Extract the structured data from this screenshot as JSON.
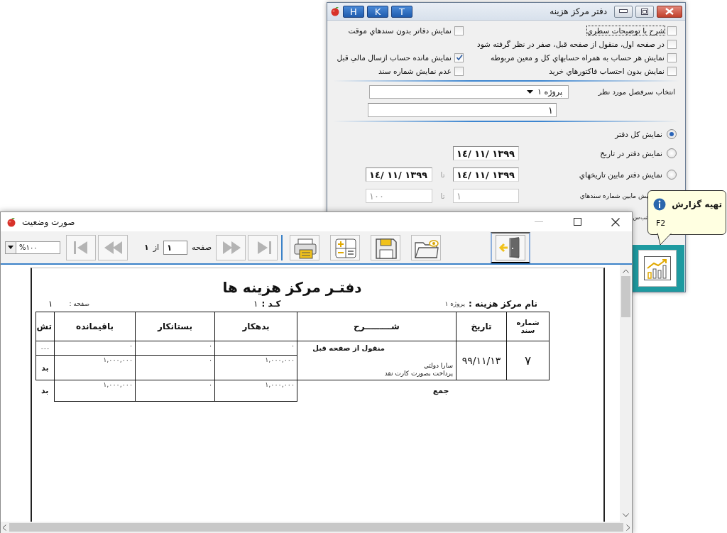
{
  "settings_dialog": {
    "title": "دفتر مركز هزينه",
    "title_buttons": [
      "T",
      "K",
      "H"
    ],
    "option_rows": [
      [
        {
          "label": "شرح با توضيحات سطري",
          "checked": false,
          "focused": true
        },
        {
          "label": "نمايش دفاتر بدون سندهاي موقت",
          "checked": false,
          "focused": false
        }
      ],
      [
        {
          "label": "در صفحه اول، منقول از صفحه قبل، صفر در نظر گرفته شود",
          "checked": false,
          "focused": false
        }
      ],
      [
        {
          "label": "نمايش هر حساب به همراه حسابهاي كل و معين مربوطه",
          "checked": false,
          "focused": false
        },
        {
          "label": "نمايش مانده حساب ازسال مالي قبل",
          "checked": true,
          "focused": false
        }
      ],
      [
        {
          "label": "نمايش بدون احتساب فاكتورهاي خريد",
          "checked": false,
          "focused": false
        },
        {
          "label": "عدم نمايش شماره سند",
          "checked": false,
          "focused": false
        }
      ]
    ],
    "cost_center": {
      "label": "انتخاب سرفصل مورد نظر",
      "value": "پروژه ١"
    },
    "account_field": {
      "value": "١"
    },
    "range_options": [
      {
        "label": "نمايش كل دفتر",
        "selected": true
      },
      {
        "label": "نمايش دفتر در تاريخ",
        "selected": false,
        "fields": [
          {
            "value": "١٣٩٩ /١١ /١٤",
            "disabled": false
          }
        ]
      },
      {
        "label": "نمايش دفتر مابين تاريخهاي",
        "selected": false,
        "separator": "تا",
        "fields": [
          {
            "value": "١٣٩٩ /١١ /١٤",
            "disabled": false
          },
          {
            "value": "١٣٩٩ /١١ /١٤",
            "disabled": false
          }
        ]
      },
      {
        "label": "يش مابين شماره سندهاي",
        "separator": "تا",
        "fields": [
          {
            "value": "١",
            "disabled": true
          },
          {
            "value": "١٠٠",
            "disabled": true
          }
        ]
      },
      {
        "label": "تب س"
      }
    ],
    "tooltip": {
      "title": "تهيه گزارش",
      "shortcut": "F2"
    }
  },
  "report_window": {
    "title": "صورت وضعيت",
    "zoom": "%١٠٠",
    "page_label": "صفحه",
    "page_value": "١",
    "of_label": "از",
    "page_count": "١",
    "nav_buttons": [
      {
        "kind": "first",
        "disabled": true
      },
      {
        "kind": "prev",
        "disabled": true
      },
      {
        "kind": "next",
        "disabled": true
      },
      {
        "kind": "last",
        "disabled": true
      }
    ],
    "tools": [
      {
        "kind": "print"
      },
      {
        "kind": "calculator"
      },
      {
        "kind": "save"
      },
      {
        "kind": "open"
      }
    ],
    "ledger": {
      "title": "دفتـر  مركز هزينه ها",
      "cost_center_label": "نام مركز هزينه :",
      "cost_center_value": "پروژه ١",
      "code_label": "كـد :",
      "code_value": "١",
      "page_label": "صفحه :",
      "page_value": "١",
      "columns": [
        "شماره سند",
        "تاريخ",
        "شـــــــــرح",
        "بدهكار",
        "بستانكار",
        "باقيمانده",
        "تش"
      ],
      "carry_row": {
        "description": "منقول از صفحه قبل",
        "debit": "٠",
        "credit": "٠",
        "balance": "٠",
        "status": "---"
      },
      "entries": [
        {
          "doc_no": "٧",
          "date": "٩٩/١١/١٣",
          "party": "سارا دولتي",
          "description": "پرداخت بصورت كارت نقد",
          "debit": "١,٠٠٠,٠٠٠",
          "credit": "٠",
          "balance": "١,٠٠٠,٠٠٠",
          "status": "بد"
        }
      ],
      "total_row": {
        "label": "جمع",
        "debit": "١,٠٠٠,٠٠٠",
        "credit": "٠",
        "balance": "١,٠٠٠,٠٠٠",
        "status": "بد"
      }
    }
  }
}
